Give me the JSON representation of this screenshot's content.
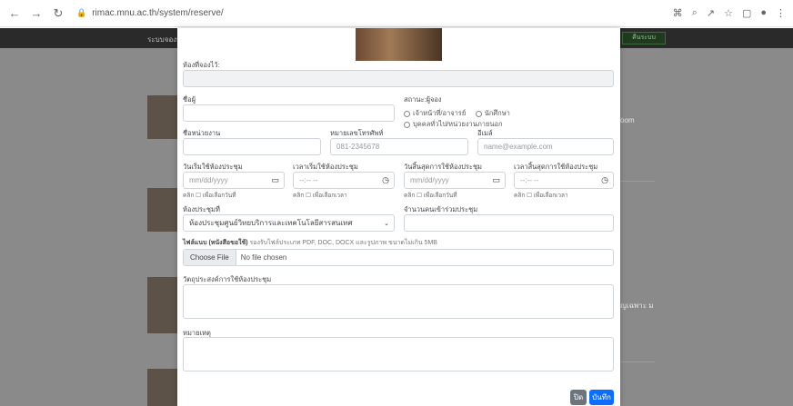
{
  "browser": {
    "url": "rimac.mnu.ac.th/system/reserve/",
    "back_icon": "arrow-left",
    "forward_icon": "arrow-right",
    "reload_icon": "reload"
  },
  "site": {
    "brand_fragment": "ระบบจองห้",
    "nav_button_fragment": "คืนระบบ",
    "right_text_1": "oom",
    "right_text_2": "ญเฉพาะ ม"
  },
  "form": {
    "room_name_label": "ห้องที่จองไว้:",
    "prefix_label": "ชื่อผู้",
    "type_label": "สถานะ:ผู้จอง",
    "type_options": [
      "เจ้าหน้าที่/อาจารย์",
      "นักศึกษา",
      "บุคคลทั่วไป/หน่วยงานภายนอก"
    ],
    "dept_label": "ชื่อหน่วยงาน",
    "phone_label": "หมายเลขโทรศัพท์",
    "phone_placeholder": "081-2345678",
    "email_label": "อีเมล์",
    "email_placeholder": "name@example.com",
    "start_date_label": "วันเริ่มใช้ห้องประชุม",
    "start_time_label": "เวลาเริ่มใช้ห้องประชุม",
    "end_date_label": "วันสิ้นสุดการใช้ห้องประชุม",
    "end_time_label": "เวลาสิ้นสุดการใช้ห้องประชุม",
    "date_placeholder": "mm/dd/yyyy",
    "time_placeholder": "--:-- --",
    "date_hint": "คลิก ☐ เพื่อเลือกวันที่",
    "time_hint": "คลิก ☐ เพื่อเลือกเวลา",
    "room_select_label": "ห้องประชุมที่",
    "room_select_value": "ห้องประชุมศูนย์วิทยบริการและเทคโนโลยีสารสนเทศ",
    "attendees_label": "จำนวนคนเข้าร่วมประชุม",
    "file_label": "ไฟล์แนบ (หนังสือขอใช้)",
    "file_hint": "รองรับไฟล์ประเภท PDF, DOC, DOCX และรูปภาพ ขนาดไม่เกิน 5MB",
    "choose_file": "Choose File",
    "no_file": "No file chosen",
    "purpose_label": "วัตถุประสงค์การใช้ห้องประชุม",
    "note_label": "หมายเหตุ",
    "close_button": "ปิด",
    "submit_button": "บันทึก"
  },
  "colors": {
    "primary": "#0d6efd",
    "secondary": "#6c757d",
    "overlay": "#8a8a8a"
  }
}
